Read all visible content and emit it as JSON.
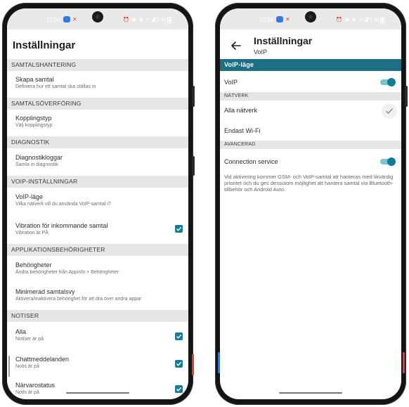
{
  "left": {
    "status": {
      "time": "12:04",
      "icons": "⏰ ◉ ✱ ᯤ◢",
      "battery": "71 %"
    },
    "header": {
      "title": "Inställningar"
    },
    "sections": {
      "call_handling": "SAMTALSHANTERING",
      "call_transfer": "SAMTALSÖVERFÖRING",
      "diagnostics": "DIAGNOSTIK",
      "voip_settings": "VOIP-INSTÄLLNINGAR",
      "app_permissions": "APPLIKATIONSBEHÖRIGHETER",
      "notifications": "NOTISER"
    },
    "items": {
      "create_call": {
        "title": "Skapa samtal",
        "subtitle": "Definiera hur ett samtal ska ställas in"
      },
      "connection_type": {
        "title": "Kopplingstyp",
        "subtitle": "Välj kopplingstyp"
      },
      "diagnostic_logs": {
        "title": "Diagnostikloggar",
        "subtitle": "Samla in diagnostik"
      },
      "voip_mode": {
        "title": "VoIP-läge",
        "subtitle": "Vilka nätverk vill du använda VoIP-samtal i?"
      },
      "vibration": {
        "title": "Vibration för inkommande samtal",
        "subtitle": "Vibration är PÅ",
        "checked": true
      },
      "permissions": {
        "title": "Behörigheter",
        "subtitle": "Ändra behörigheter från Appinfo > Behörigheter"
      },
      "minimized_view": {
        "title": "Minimerad samtalsvy",
        "subtitle": "Aktivera/inaktivera behörighet för att dra över andra appar"
      },
      "all": {
        "title": "Alla",
        "subtitle": "Notiser är på",
        "checked": true
      },
      "chat": {
        "title": "Chattmeddelanden",
        "subtitle": "Notis är på",
        "checked": true
      },
      "presence": {
        "title": "Närvarostatus",
        "subtitle": "Notis är på",
        "checked": true
      }
    }
  },
  "right": {
    "status": {
      "time": "12:04",
      "icons": "⏰ ◉ ✱ ᯤ◢",
      "battery": "71 %"
    },
    "header": {
      "title": "Inställningar",
      "subtitle": "VoIP"
    },
    "sections": {
      "voip_mode": "VoIP-läge",
      "network": "NÄTVERK",
      "advanced": "AVANCERAD"
    },
    "items": {
      "voip": {
        "title": "VoIP",
        "enabled": true
      },
      "all_networks": {
        "title": "Alla nätverk",
        "selected": true
      },
      "wifi_only": {
        "title": "Endast Wi-Fi",
        "selected": false
      },
      "connection_service": {
        "title": "Connection service",
        "enabled": true
      }
    },
    "description": "Vid aktivering kommer GSM- och VoIP-samtal att hanteras med likvärdig prioritet och du ges dessutom möjlighet att hantera samtal via Bluetooth-tillbehör och Android Auto."
  },
  "colors": {
    "accent": "#127d95",
    "section_dark": "#1e6f86",
    "section_light": "#e6e6e6"
  }
}
